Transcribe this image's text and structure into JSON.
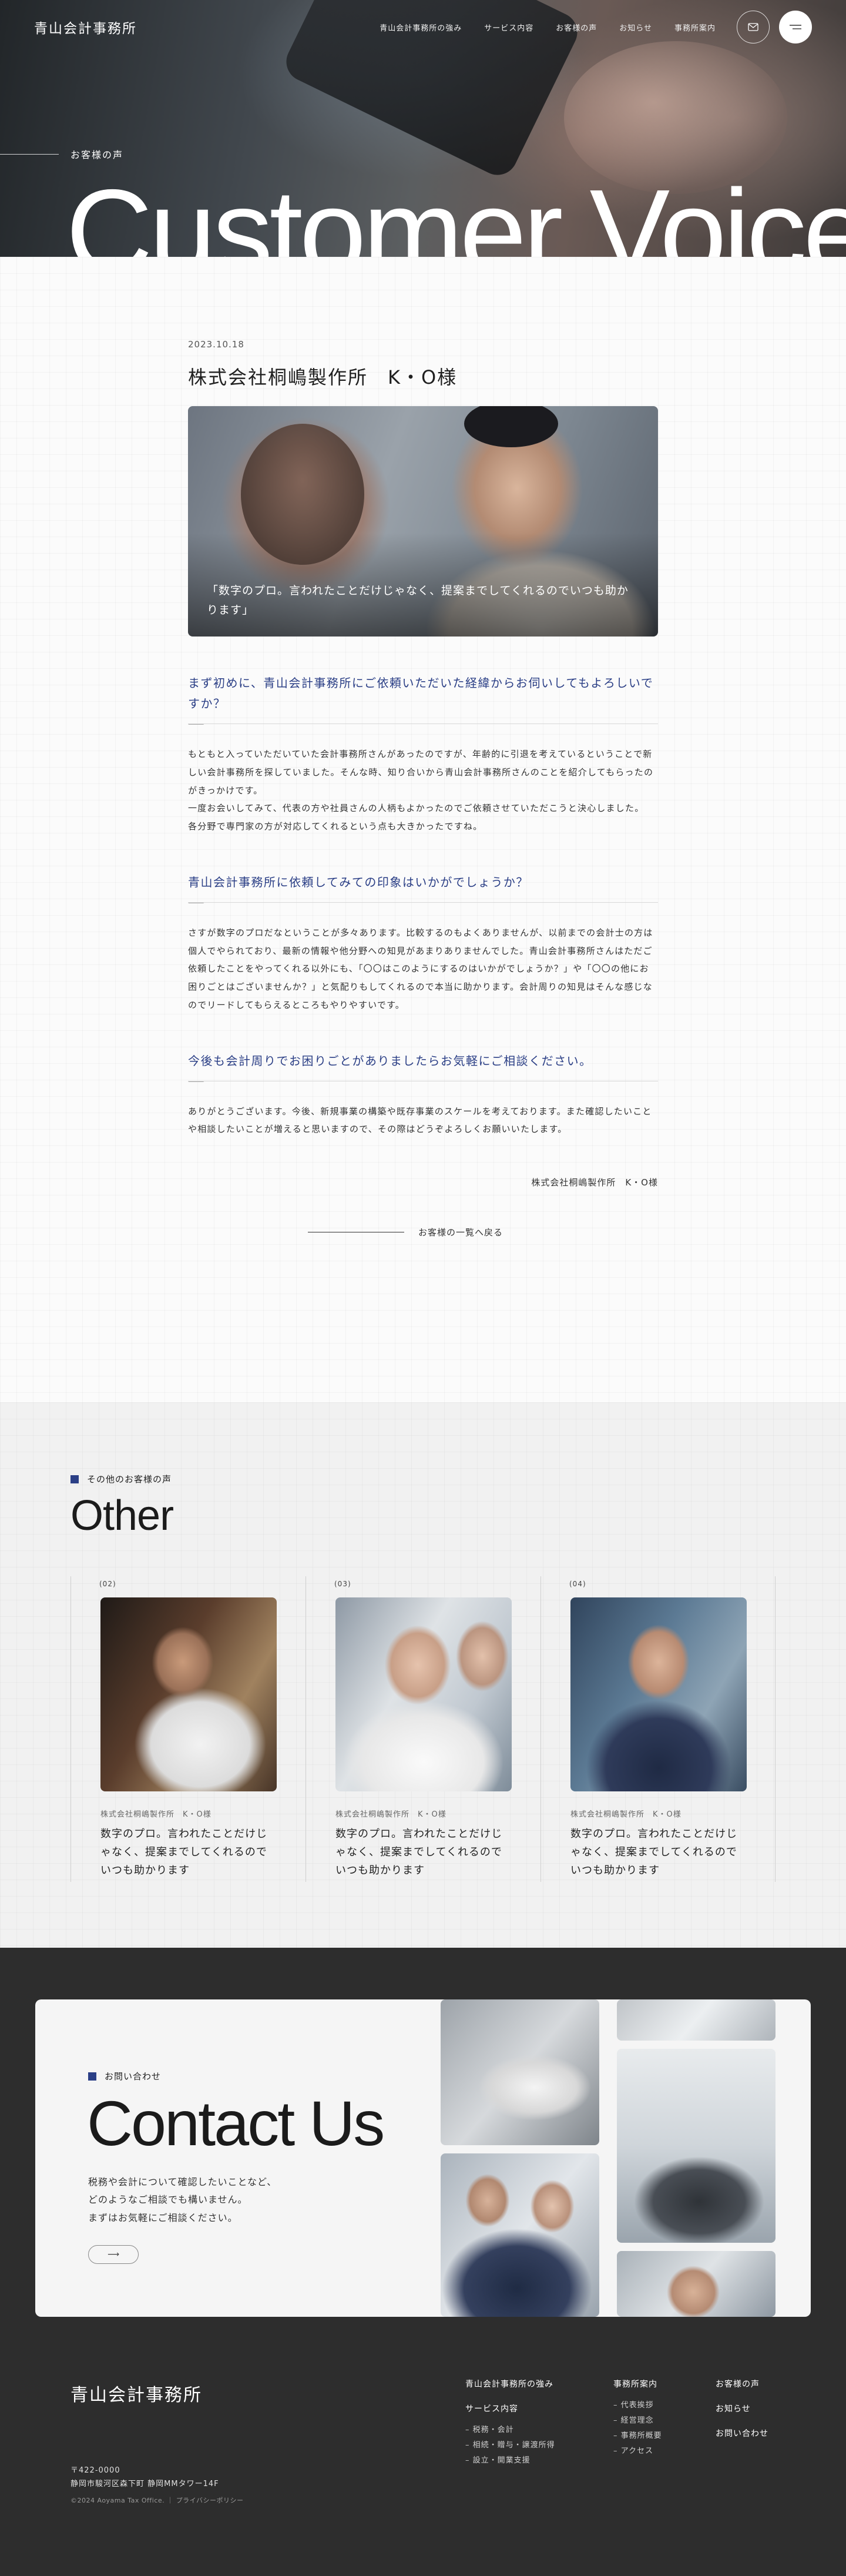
{
  "header": {
    "logo": "青山会計事務所",
    "nav": [
      "青山会計事務所の強み",
      "サービス内容",
      "お客様の声",
      "お知らせ",
      "事務所案内"
    ]
  },
  "hero": {
    "sub": "お客様の声",
    "title": "Customer Voice"
  },
  "article": {
    "date": "2023.10.18",
    "title": "株式会社桐嶋製作所　K・O様",
    "photo_caption": "「数字のプロ。言われたことだけじゃなく、提案までしてくれるのでいつも助かります」",
    "qa": [
      {
        "q": "まず初めに、青山会計事務所にご依頼いただいた経緯からお伺いしてもよろしいですか？",
        "a": [
          "もともと入っていただいていた会計事務所さんがあったのですが、年齢的に引退を考えているということで新しい会計事務所を探していました。そんな時、知り合いから青山会計事務所さんのことを紹介してもらったのがきっかけです。",
          "一度お会いしてみて、代表の方や社員さんの人柄もよかったのでご依頼させていただこうと決心しました。",
          "各分野で専門家の方が対応してくれるという点も大きかったですね。"
        ]
      },
      {
        "q": "青山会計事務所に依頼してみての印象はいかがでしょうか？",
        "a": [
          "さすが数字のプロだなということが多々あります。比較するのもよくありませんが、以前までの会計士の方は個人でやられており、最新の情報や他分野への知見があまりありませんでした。青山会計事務所さんはただご依頼したことをやってくれる以外にも、「〇〇はこのようにするのはいかがでしょうか？」や「〇〇の他にお困りごとはございませんか？」と気配りもしてくれるので本当に助かります。会計周りの知見はそんな感じなのでリードしてもらえるところもやりやすいです。"
        ]
      },
      {
        "q": "今後も会計周りでお困りごとがありましたらお気軽にご相談ください。",
        "a": [
          "ありがとうございます。今後、新規事業の構築や既存事業のスケールを考えております。また確認したいことや相談したいことが増えると思いますので、その際はどうぞよろしくお願いいたします。"
        ]
      }
    ],
    "signature": "株式会社桐嶋製作所　K・O様",
    "back_label": "お客様の一覧へ戻る"
  },
  "other": {
    "label": "その他のお客様の声",
    "title": "Other",
    "cards": [
      {
        "num": "(02)",
        "company": "株式会社桐嶋製作所　K・O様",
        "text": "数字のプロ。言われたことだけじゃなく、提案までしてくれるのでいつも助かります"
      },
      {
        "num": "(03)",
        "company": "株式会社桐嶋製作所　K・O様",
        "text": "数字のプロ。言われたことだけじゃなく、提案までしてくれるのでいつも助かります"
      },
      {
        "num": "(04)",
        "company": "株式会社桐嶋製作所　K・O様",
        "text": "数字のプロ。言われたことだけじゃなく、提案までしてくれるのでいつも助かります"
      }
    ]
  },
  "contact": {
    "label": "お問い合わせ",
    "title": "Contact Us",
    "text": [
      "税務や会計について確認したいことなど、",
      "どのようなご相談でも構いません。",
      "まずはお気軽にご相談ください。"
    ],
    "button_arrow": "⟶"
  },
  "footer": {
    "logo": "青山会計事務所",
    "address_zip": "〒422-0000",
    "address": "静岡市駿河区森下町 静岡MMタワー14F",
    "copyright": "©2024 Aoyama Tax Office.",
    "privacy": "プライバシーポリシー",
    "col1": {
      "heading1": "青山会計事務所の強み",
      "heading2": "サービス内容",
      "items": [
        "税務・会計",
        "相続・贈与・譲渡所得",
        "設立・開業支援"
      ]
    },
    "col2": {
      "heading": "事務所案内",
      "items": [
        "代表挨拶",
        "経営理念",
        "事務所概要",
        "アクセス"
      ]
    },
    "col3": {
      "items": [
        "お客様の声",
        "お知らせ",
        "お問い合わせ"
      ]
    }
  },
  "colors": {
    "accent": "#2b3f86",
    "dark": "#2d2d2d"
  },
  "icons": {
    "mail": "mail-icon",
    "menu": "menu-icon"
  }
}
